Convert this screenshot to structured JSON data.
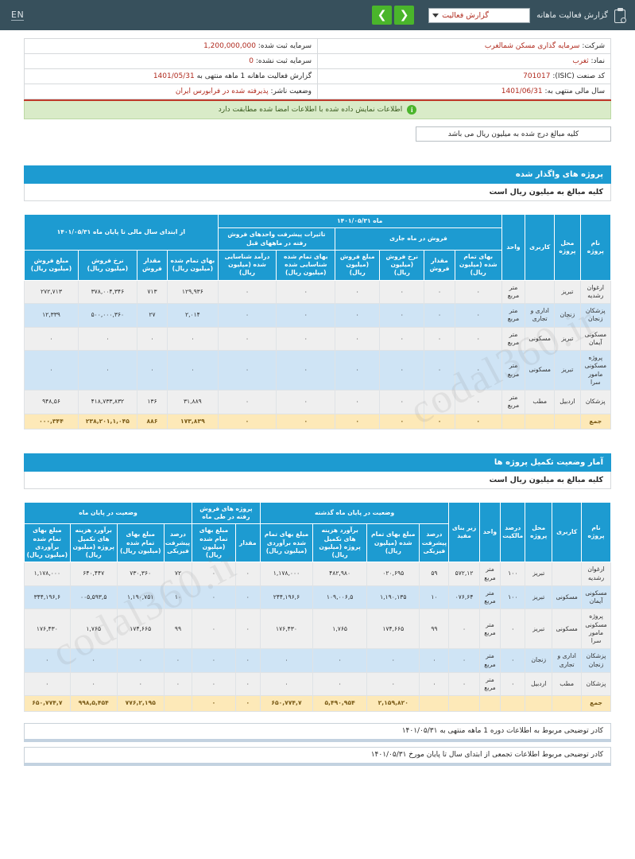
{
  "topbar": {
    "clip_icon": "clipboard-icon",
    "title": "گزارش فعالیت ماهانه",
    "select_value": "گزارش فعالیت",
    "prev_label": "❮",
    "next_label": "❯",
    "lang_toggle": "EN"
  },
  "info": {
    "company_label": "شرکت:",
    "company_value": "سرمایه گذاری مسکن شمالغرب",
    "symbol_label": "نماد:",
    "symbol_value": "ثغرب",
    "isic_label": "کد صنعت (ISIC):",
    "isic_value": "701017",
    "fiscal_label": "سال مالی منتهی به:",
    "fiscal_value": "1401/06/31",
    "capital_reg_label": "سرمایه ثبت شده:",
    "capital_reg_value": "1,200,000,000",
    "capital_unreg_label": "سرمایه ثبت نشده:",
    "capital_unreg_value": "0",
    "period_label": "گزارش فعالیت ماهانه  1 ماهه منتهی به",
    "period_value": "1401/05/31",
    "status_label": "وضعیت ناشر:",
    "status_value": "پذیرفته شده در فرابورس ایران"
  },
  "notice": {
    "icon": "info-icon",
    "text": "اطلاعات نمایش داده شده با اطلاعات امضا شده مطابقت دارد"
  },
  "unit_box": "کلیه مبالغ درج شده به میلیون ریال می باشد",
  "watermark": "codal360.ir",
  "section1": {
    "bar_title": "پروژه های واگذار شده",
    "sub_title": "کلیه مبالغ به میلیون ریال است",
    "headers": {
      "project_name": "نام پروژه",
      "location": "محل پروژه",
      "usage": "کاربری",
      "unit": "واحد",
      "month_group": "ماه ۱۴۰۱/۰۵/۳۱",
      "ytd_group": "از ابتدای سال مالی تا پایان ماه ۱۴۰۱/۰۵/۳۱",
      "current_month_sales": "فروش در ماه جاری",
      "progress_changes": "تاثیرات پیشرفت واحدهای فروش رفته در ماههای قبل",
      "cm_cost": "بهای تمام شده (میلیون ریال)",
      "cm_qty": "مقدار فروش",
      "cm_rate": "نرخ فروش (میلیون ریال)",
      "cm_amount": "مبلغ فروش (میلیون ریال)",
      "pc_cost": "بهای تمام شده شناسایی شده (میلیون ریال)",
      "pc_revenue": "درآمد شناسایی شده (میلیون ریال)",
      "ytd_cost": "بهای تمام شده (میلیون ریال)",
      "ytd_qty": "مقدار فروش",
      "ytd_rate": "نرخ فروش (میلیون ریال)",
      "ytd_amount": "مبلغ فروش (میلیون ریال)"
    },
    "rows": [
      {
        "project_name": "ارغوان رشدیه",
        "location": "تبریز",
        "usage": "",
        "unit": "متر مربع",
        "cm_cost": "٠",
        "cm_qty": "٠",
        "cm_rate": "٠",
        "cm_amount": "٠",
        "pc_cost": "٠",
        "pc_revenue": "٠",
        "ytd_cost": "١٢٩,٩٣۶",
        "ytd_qty": "٧١٣",
        "ytd_rate": "٣۴۶,٠٠۴,٣٧٨",
        "ytd_amount": "٢٧٢,٧١٣"
      },
      {
        "project_name": "پزشکان زنجان",
        "location": "زنجان",
        "usage": "اداری و تجاری",
        "unit": "متر مربع",
        "cm_cost": "٠",
        "cm_qty": "٠",
        "cm_rate": "٠",
        "cm_amount": "٠",
        "pc_cost": "٠",
        "pc_revenue": "٠",
        "ytd_cost": "٢,٠١۴",
        "ytd_qty": "٢٧",
        "ytd_rate": "٣۶٠,۵٠٠,٠٠٠",
        "ytd_amount": "١٢,٣٣٩"
      },
      {
        "project_name": "مسکونی آیمان",
        "location": "تبریز",
        "usage": "مسکونی",
        "unit": "متر مربع",
        "cm_cost": "٠",
        "cm_qty": "٠",
        "cm_rate": "٠",
        "cm_amount": "٠",
        "pc_cost": "٠",
        "pc_revenue": "٠",
        "ytd_cost": "٠",
        "ytd_qty": "٠",
        "ytd_rate": "٠",
        "ytd_amount": "٠"
      },
      {
        "project_name": "پروژه مسکونی مامور سرا",
        "location": "تبریز",
        "usage": "مسکونی",
        "unit": "متر مربع",
        "cm_cost": "٠",
        "cm_qty": "٠",
        "cm_rate": "٠",
        "cm_amount": "٠",
        "pc_cost": "٠",
        "pc_revenue": "٠",
        "ytd_cost": "٠",
        "ytd_qty": "٠",
        "ytd_rate": "٠",
        "ytd_amount": "٠"
      },
      {
        "project_name": "پزشکان",
        "location": "اردبیل",
        "usage": "مطب",
        "unit": "متر مربع",
        "cm_cost": "٠",
        "cm_qty": "٠",
        "cm_rate": "٠",
        "cm_amount": "٠",
        "pc_cost": "٠",
        "pc_revenue": "٠",
        "ytd_cost": "٣١,٨٨٩",
        "ytd_qty": "١٣۶",
        "ytd_rate": "۴١٨,٧٣٣,٨٣٢",
        "ytd_amount": "۵۶,٩۴٨"
      }
    ],
    "total": {
      "label": "جمع",
      "location": "",
      "usage": "",
      "unit": "",
      "cm_cost": "٠",
      "cm_qty": "٠",
      "cm_rate": "٠",
      "cm_amount": "٠",
      "pc_cost": "٠",
      "pc_revenue": "٠",
      "ytd_cost": "١٧٣,٨٣٩",
      "ytd_qty": "٨٨۶",
      "ytd_rate": "١,٠۴۵,٢٣٨,٢٠١",
      "ytd_amount": "٣۴۴,٠٠٠"
    }
  },
  "section2": {
    "bar_title": "آمار وضعیت تکمیل پروژه ها",
    "sub_title": "کلیه مبالغ به میلیون ریال است",
    "headers": {
      "project_name": "نام پروژه",
      "usage": "کاربری",
      "location": "محل پروژه",
      "ownership_pct": "درصد مالکیت",
      "unit": "واحد",
      "area": "زیر بنای مفید",
      "last_month_group": "وضعیت در پایان ماه گذشته",
      "sold_in_month_group": "پروژه های فروش رفته در طی ماه",
      "end_of_month_group": "وضعیت در پایان ماه",
      "lm_progress": "درصد پیشرفت فیزیکی",
      "lm_cost_incurred": "مبلغ بهای تمام شده (میلیون ریال)",
      "lm_est_completion": "برآورد هزینه های تکمیل پروژه (میلیون ریال)",
      "lm_total_est": "مبلغ بهای تمام شده برآوردی (میلیون ریال)",
      "sold_qty": "مقدار",
      "sold_cost": "مبلغ بهای تمام شده (میلیون ریال)",
      "eom_progress": "درصد پیشرفت فیزیکی",
      "eom_cost_incurred": "مبلغ بهای تمام شده (میلیون ریال)",
      "eom_est_completion": "برآورد هزینه های تکمیل پروژه (میلیون ریال)",
      "eom_total_est": "مبلغ بهای تمام شده برآوردی (میلیون ریال)"
    },
    "rows": [
      {
        "project_name": "ارغوان رشدیه",
        "location": "تبریز",
        "usage": "",
        "ownership_pct": "١٠٠",
        "unit": "متر مربع",
        "area": "١٢,۵٧٢",
        "lm_progress": "۵٩",
        "lm_cost_incurred": "۶٩۵,٠٢٠",
        "lm_est_completion": "۴٨٢,٩٨٠",
        "lm_total_est": "١,١٧٨,٠٠٠",
        "sold_qty": "٠",
        "sold_cost": "٠",
        "eom_progress": "٧٢",
        "eom_cost_incurred": "٧٣٠,٣۶٠",
        "eom_est_completion": "۴۴٧,۶۴٠",
        "eom_total_est": "١,١٧٨,٠٠٠"
      },
      {
        "project_name": "مسکونی آیمان",
        "location": "تبریز",
        "usage": "مسکونی",
        "ownership_pct": "١٠٠",
        "unit": "متر مربع",
        "area": "۶۴,٠٧۶",
        "lm_progress": "١٠",
        "lm_cost_incurred": "١,١٩٠,١٣۵",
        "lm_est_completion": "۵,٠٠۶,١٠٩",
        "lm_total_est": "۶,١٩۶,٢۴۴",
        "sold_qty": "٠",
        "sold_cost": "٠",
        "eom_progress": "١٠",
        "eom_cost_incurred": "١,١٩٠,٧۵١",
        "eom_est_completion": "۵,٠٠۵,۵٩٣",
        "eom_total_est": "۶,١٩۶,٣۴۴"
      },
      {
        "project_name": "پروژه مسکونی مامور سرا",
        "location": "تبریز",
        "usage": "مسکونی",
        "ownership_pct": "٠",
        "unit": "متر مربع",
        "area": "٠",
        "lm_progress": "٩٩",
        "lm_cost_incurred": "١٧۴,۶۶۵",
        "lm_est_completion": "١,٧۶۵",
        "lm_total_est": "١٧۶,۴٣٠",
        "sold_qty": "٠",
        "sold_cost": "٠",
        "eom_progress": "٩٩",
        "eom_cost_incurred": "١٧۴,۶۶۵",
        "eom_est_completion": "١,٧۶۵",
        "eom_total_est": "١٧۶,۴٣٠"
      },
      {
        "project_name": "پزشکان زنجان",
        "location": "زنجان",
        "usage": "اداری و تجاری",
        "ownership_pct": "٠",
        "unit": "متر مربع",
        "area": "٠",
        "lm_progress": "٠",
        "lm_cost_incurred": "٠",
        "lm_est_completion": "٠",
        "lm_total_est": "٠",
        "sold_qty": "٠",
        "sold_cost": "٠",
        "eom_progress": "٠",
        "eom_cost_incurred": "٠",
        "eom_est_completion": "٠",
        "eom_total_est": "٠"
      },
      {
        "project_name": "پزشکان",
        "location": "اردبیل",
        "usage": "مطب",
        "ownership_pct": "٠",
        "unit": "متر مربع",
        "area": "٠",
        "lm_progress": "٠",
        "lm_cost_incurred": "٠",
        "lm_est_completion": "٠",
        "lm_total_est": "٠",
        "sold_qty": "٠",
        "sold_cost": "٠",
        "eom_progress": "٠",
        "eom_cost_incurred": "٠",
        "eom_est_completion": "٠",
        "eom_total_est": "٠"
      }
    ],
    "total": {
      "label": "جمع",
      "location": "",
      "usage": "",
      "ownership_pct": "",
      "unit": "",
      "area": "",
      "lm_progress": "",
      "lm_cost_incurred": "٢,١۵٩,٨٢٠",
      "lm_est_completion": "۵,۴٩٠,٩۵۴",
      "lm_total_est": "٧,۶۵٠,٧٧۴",
      "sold_qty": "٠",
      "sold_cost": "٠",
      "eom_progress": "",
      "eom_cost_incurred": "٢,١٩۵,٧٧۶",
      "eom_est_completion": "۵,۴۵۴,٩٩٨",
      "eom_total_est": "٧,۶۵٠,٧٧۴"
    }
  },
  "footer": {
    "note1": "کادر توضیحی مربوط به اطلاعات دوره 1 ماهه منتهی به ۱۴۰۱/۰۵/۳۱",
    "note2": "کادر توضیحی مربوط اطلاعات تجمعی از ابتدای سال تا پایان مورخ ۱۴۰۱/۰۵/۳۱"
  }
}
